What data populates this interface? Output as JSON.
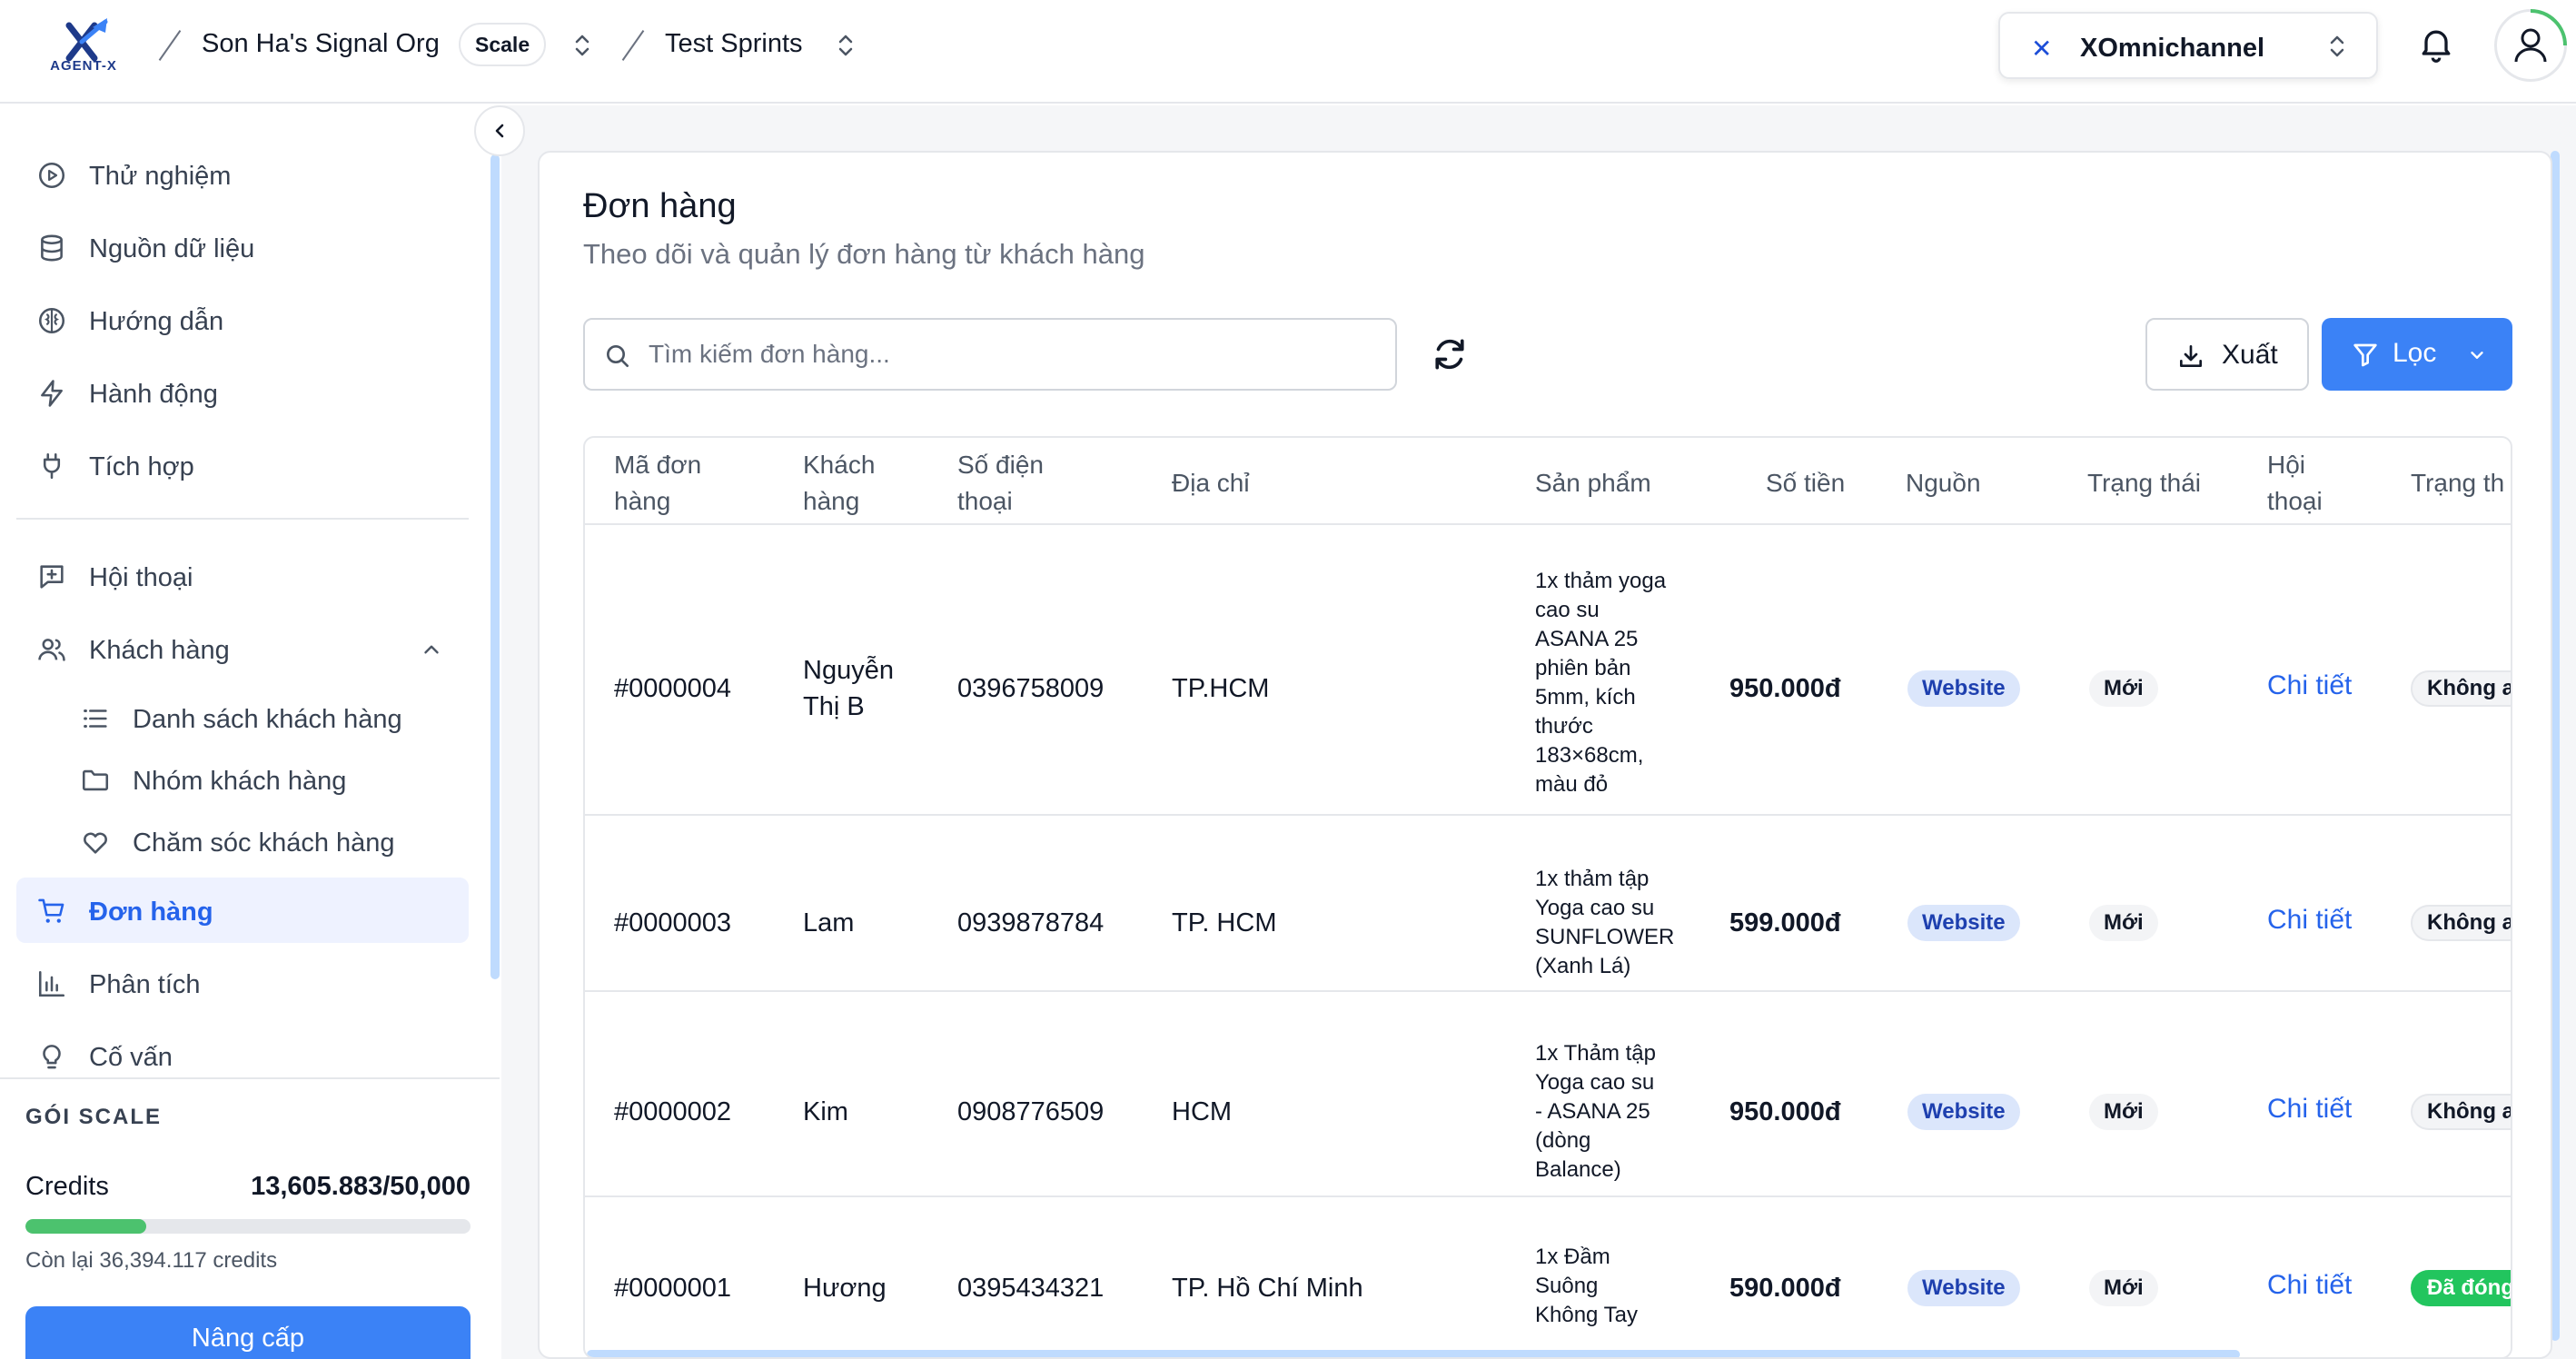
{
  "topbar": {
    "logo_text": "AGENT-X",
    "org_name": "Son Ha's Signal Org",
    "plan_badge": "Scale",
    "project_name": "Test Sprints",
    "channel_name": "XOmnichannel"
  },
  "sidebar": {
    "items": [
      {
        "label": "Thử nghiệm",
        "icon": "play-circle-icon"
      },
      {
        "label": "Nguồn dữ liệu",
        "icon": "database-icon"
      },
      {
        "label": "Hướng dẫn",
        "icon": "brain-icon"
      },
      {
        "label": "Hành động",
        "icon": "lightning-icon"
      },
      {
        "label": "Tích hợp",
        "icon": "plug-icon"
      },
      {
        "label": "Hội thoại",
        "icon": "message-plus-icon"
      },
      {
        "label": "Khách hàng",
        "icon": "users-icon"
      },
      {
        "label": "Danh sách khách hàng",
        "icon": "list-icon"
      },
      {
        "label": "Nhóm khách hàng",
        "icon": "folder-icon"
      },
      {
        "label": "Chăm sóc khách hàng",
        "icon": "heart-icon"
      },
      {
        "label": "Đơn hàng",
        "icon": "cart-icon"
      },
      {
        "label": "Phân tích",
        "icon": "bar-chart-icon"
      },
      {
        "label": "Cố vấn",
        "icon": "lightbulb-icon"
      }
    ],
    "active_item": "Đơn hàng"
  },
  "plan": {
    "title": "GÓI SCALE",
    "credits_label": "Credits",
    "credits_value": "13,605.883/50,000",
    "credits_used_fraction": 0.272,
    "remaining": "Còn lại 36,394.117 credits",
    "upgrade_label": "Nâng cấp"
  },
  "page": {
    "title": "Đơn hàng",
    "subtitle": "Theo dõi và quản lý đơn hàng từ khách hàng",
    "search_placeholder": "Tìm kiếm đơn hàng...",
    "export_label": "Xuất",
    "filter_label": "Lọc"
  },
  "table": {
    "headers": {
      "order_id_1": "Mã đơn",
      "order_id_2": "hàng",
      "customer_1": "Khách",
      "customer_2": "hàng",
      "phone_1": "Số điện",
      "phone_2": "thoại",
      "address": "Địa chỉ",
      "product": "Sản phẩm",
      "amount": "Số tiền",
      "source": "Nguồn",
      "status": "Trạng thái",
      "conversation_1": "Hội",
      "conversation_2": "thoại",
      "conv_status": "Trạng th"
    },
    "rows": [
      {
        "order_id": "#0000004",
        "customer_1": "Nguyễn",
        "customer_2": "Thị B",
        "phone": "0396758009",
        "address": "TP.HCM",
        "product_lines": [
          "1x thảm yoga",
          "cao su",
          "ASANA 25",
          "phiên bản",
          "5mm, kích",
          "thước",
          "183×68cm,",
          "màu đỏ"
        ],
        "amount": "950.000đ",
        "source": "Website",
        "status": "Mới",
        "conversation": "Chi tiết",
        "conv_status": "Không a"
      },
      {
        "order_id": "#0000003",
        "customer_1": "Lam",
        "customer_2": "",
        "phone": "0939878784",
        "address": "TP. HCM",
        "product_lines": [
          "1x thảm tập",
          "Yoga cao su",
          "SUNFLOWER",
          "(Xanh Lá)"
        ],
        "amount": "599.000đ",
        "source": "Website",
        "status": "Mới",
        "conversation": "Chi tiết",
        "conv_status": "Không a"
      },
      {
        "order_id": "#0000002",
        "customer_1": "Kim",
        "customer_2": "",
        "phone": "0908776509",
        "address": "HCM",
        "product_lines": [
          "1x Thảm tập",
          "Yoga cao su",
          "- ASANA 25",
          "(dòng",
          "Balance)"
        ],
        "amount": "950.000đ",
        "source": "Website",
        "status": "Mới",
        "conversation": "Chi tiết",
        "conv_status": "Không a"
      },
      {
        "order_id": "#0000001",
        "customer_1": "Hương",
        "customer_2": "",
        "phone": "0395434321",
        "address": "TP. Hồ Chí Minh",
        "product_lines": [
          "1x Đầm",
          "Suông",
          "Không Tay"
        ],
        "amount": "590.000đ",
        "source": "Website",
        "status": "Mới",
        "conversation": "Chi tiết",
        "conv_status": "Đã đóng"
      }
    ]
  },
  "colors": {
    "accent": "#3b82f6",
    "link": "#2563eb",
    "active_bg": "#eef2ff",
    "credits_bar": "#4cc26e",
    "closed_badge": "#22c55e"
  }
}
